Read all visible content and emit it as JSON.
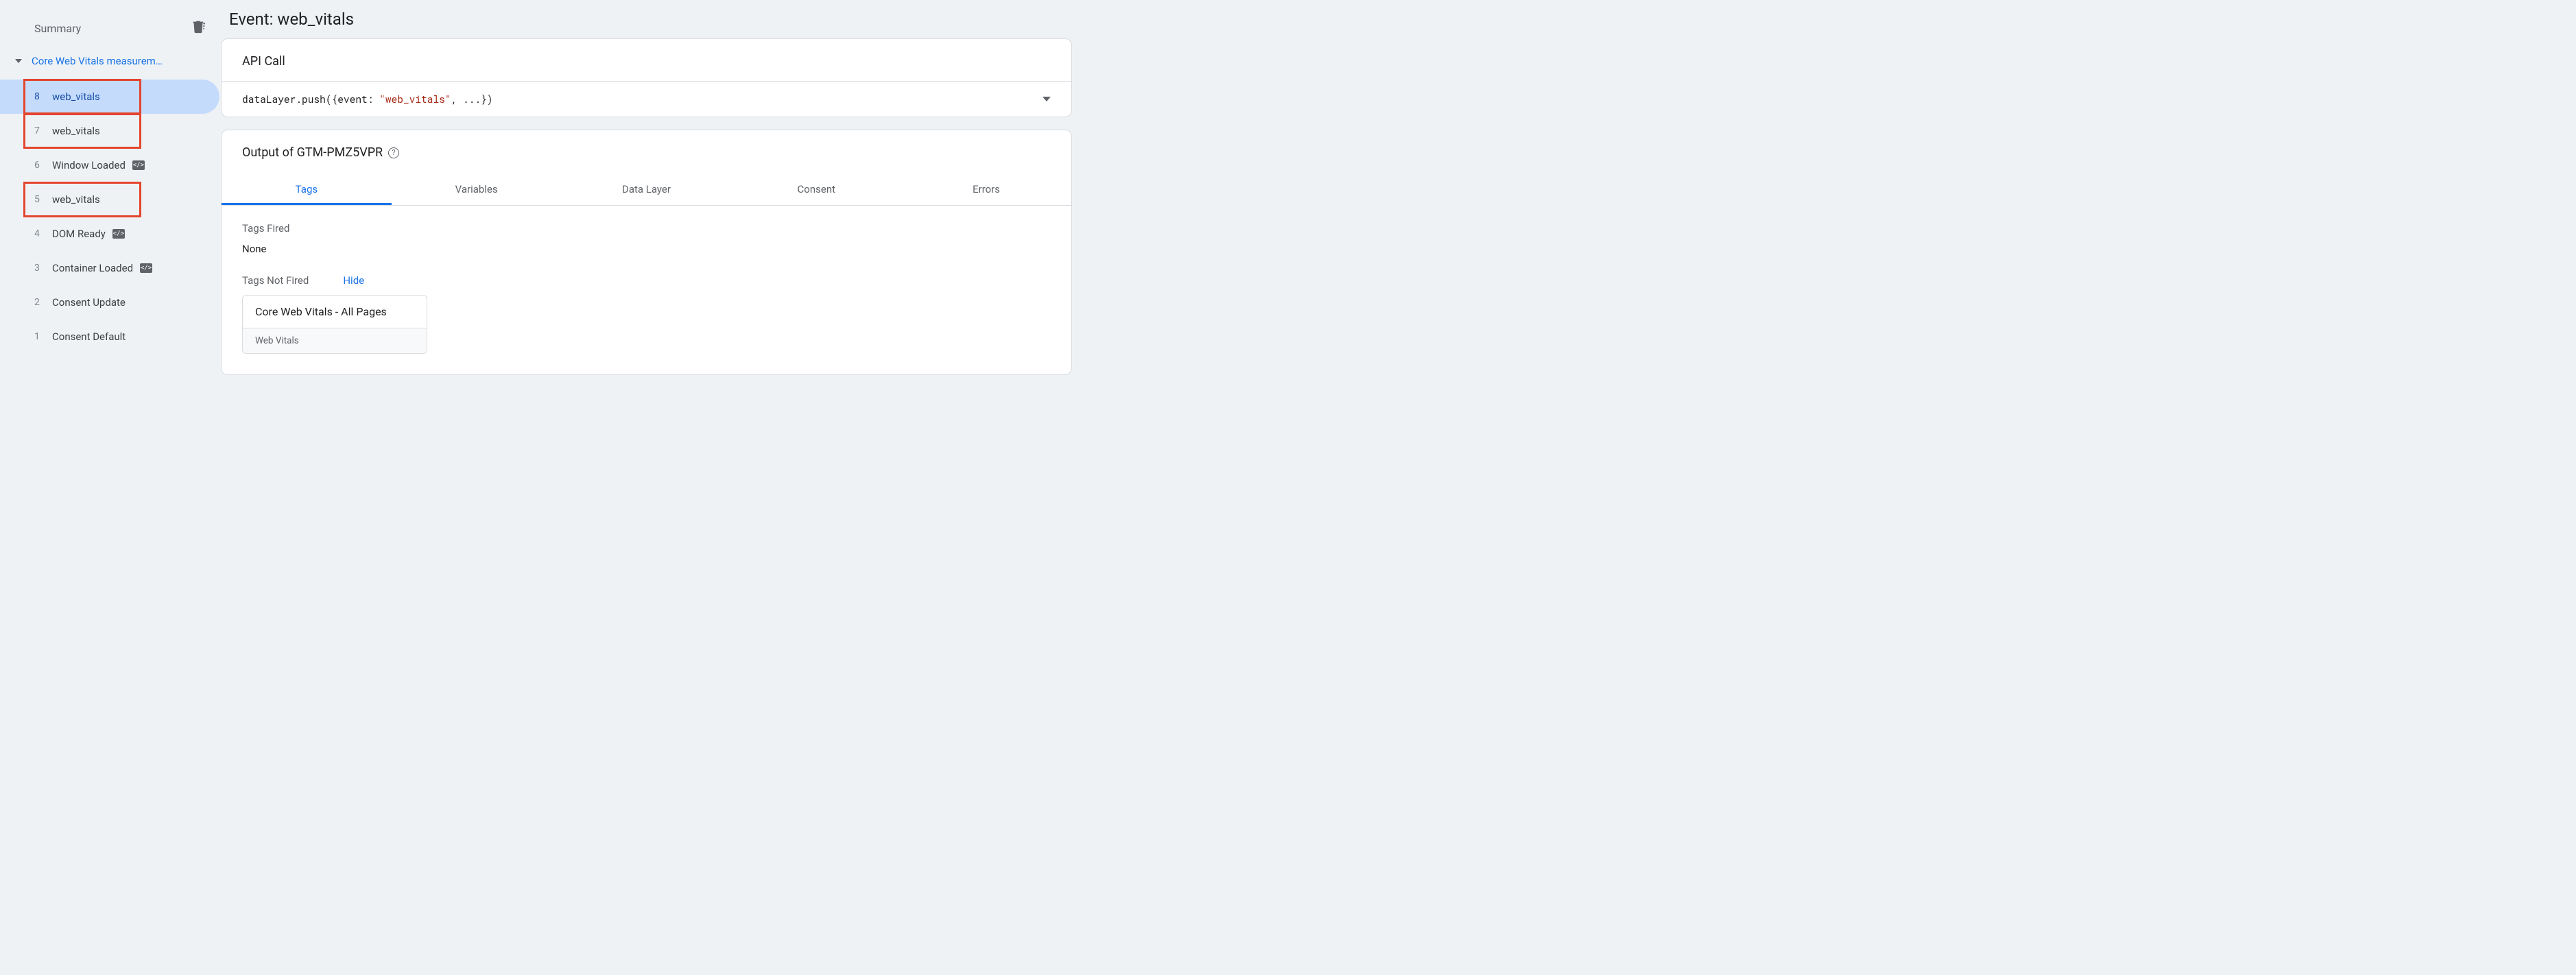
{
  "sidebar": {
    "summary_label": "Summary",
    "source_label": "Core Web Vitals measurem…",
    "events": [
      {
        "num": "8",
        "label": "web_vitals",
        "selected": true,
        "highlight": true,
        "code_chip": false
      },
      {
        "num": "7",
        "label": "web_vitals",
        "selected": false,
        "highlight": true,
        "code_chip": false
      },
      {
        "num": "6",
        "label": "Window Loaded",
        "selected": false,
        "highlight": false,
        "code_chip": true
      },
      {
        "num": "5",
        "label": "web_vitals",
        "selected": false,
        "highlight": true,
        "code_chip": false
      },
      {
        "num": "4",
        "label": "DOM Ready",
        "selected": false,
        "highlight": false,
        "code_chip": true
      },
      {
        "num": "3",
        "label": "Container Loaded",
        "selected": false,
        "highlight": false,
        "code_chip": true
      },
      {
        "num": "2",
        "label": "Consent Update",
        "selected": false,
        "highlight": false,
        "code_chip": false
      },
      {
        "num": "1",
        "label": "Consent Default",
        "selected": false,
        "highlight": false,
        "code_chip": false
      }
    ]
  },
  "main": {
    "event_title": "Event: web_vitals",
    "api_call_header": "API Call",
    "api_call_prefix": "dataLayer.push({event: ",
    "api_call_value": "\"web_vitals\"",
    "api_call_suffix": ", ...})",
    "output_header": "Output of GTM-PMZ5VPR",
    "tabs": [
      "Tags",
      "Variables",
      "Data Layer",
      "Consent",
      "Errors"
    ],
    "active_tab_index": 0,
    "tags_fired_label": "Tags Fired",
    "tags_fired_none": "None",
    "tags_not_fired_label": "Tags Not Fired",
    "hide_label": "Hide",
    "not_fired_card": {
      "title": "Core Web Vitals - All Pages",
      "type": "Web Vitals"
    }
  }
}
